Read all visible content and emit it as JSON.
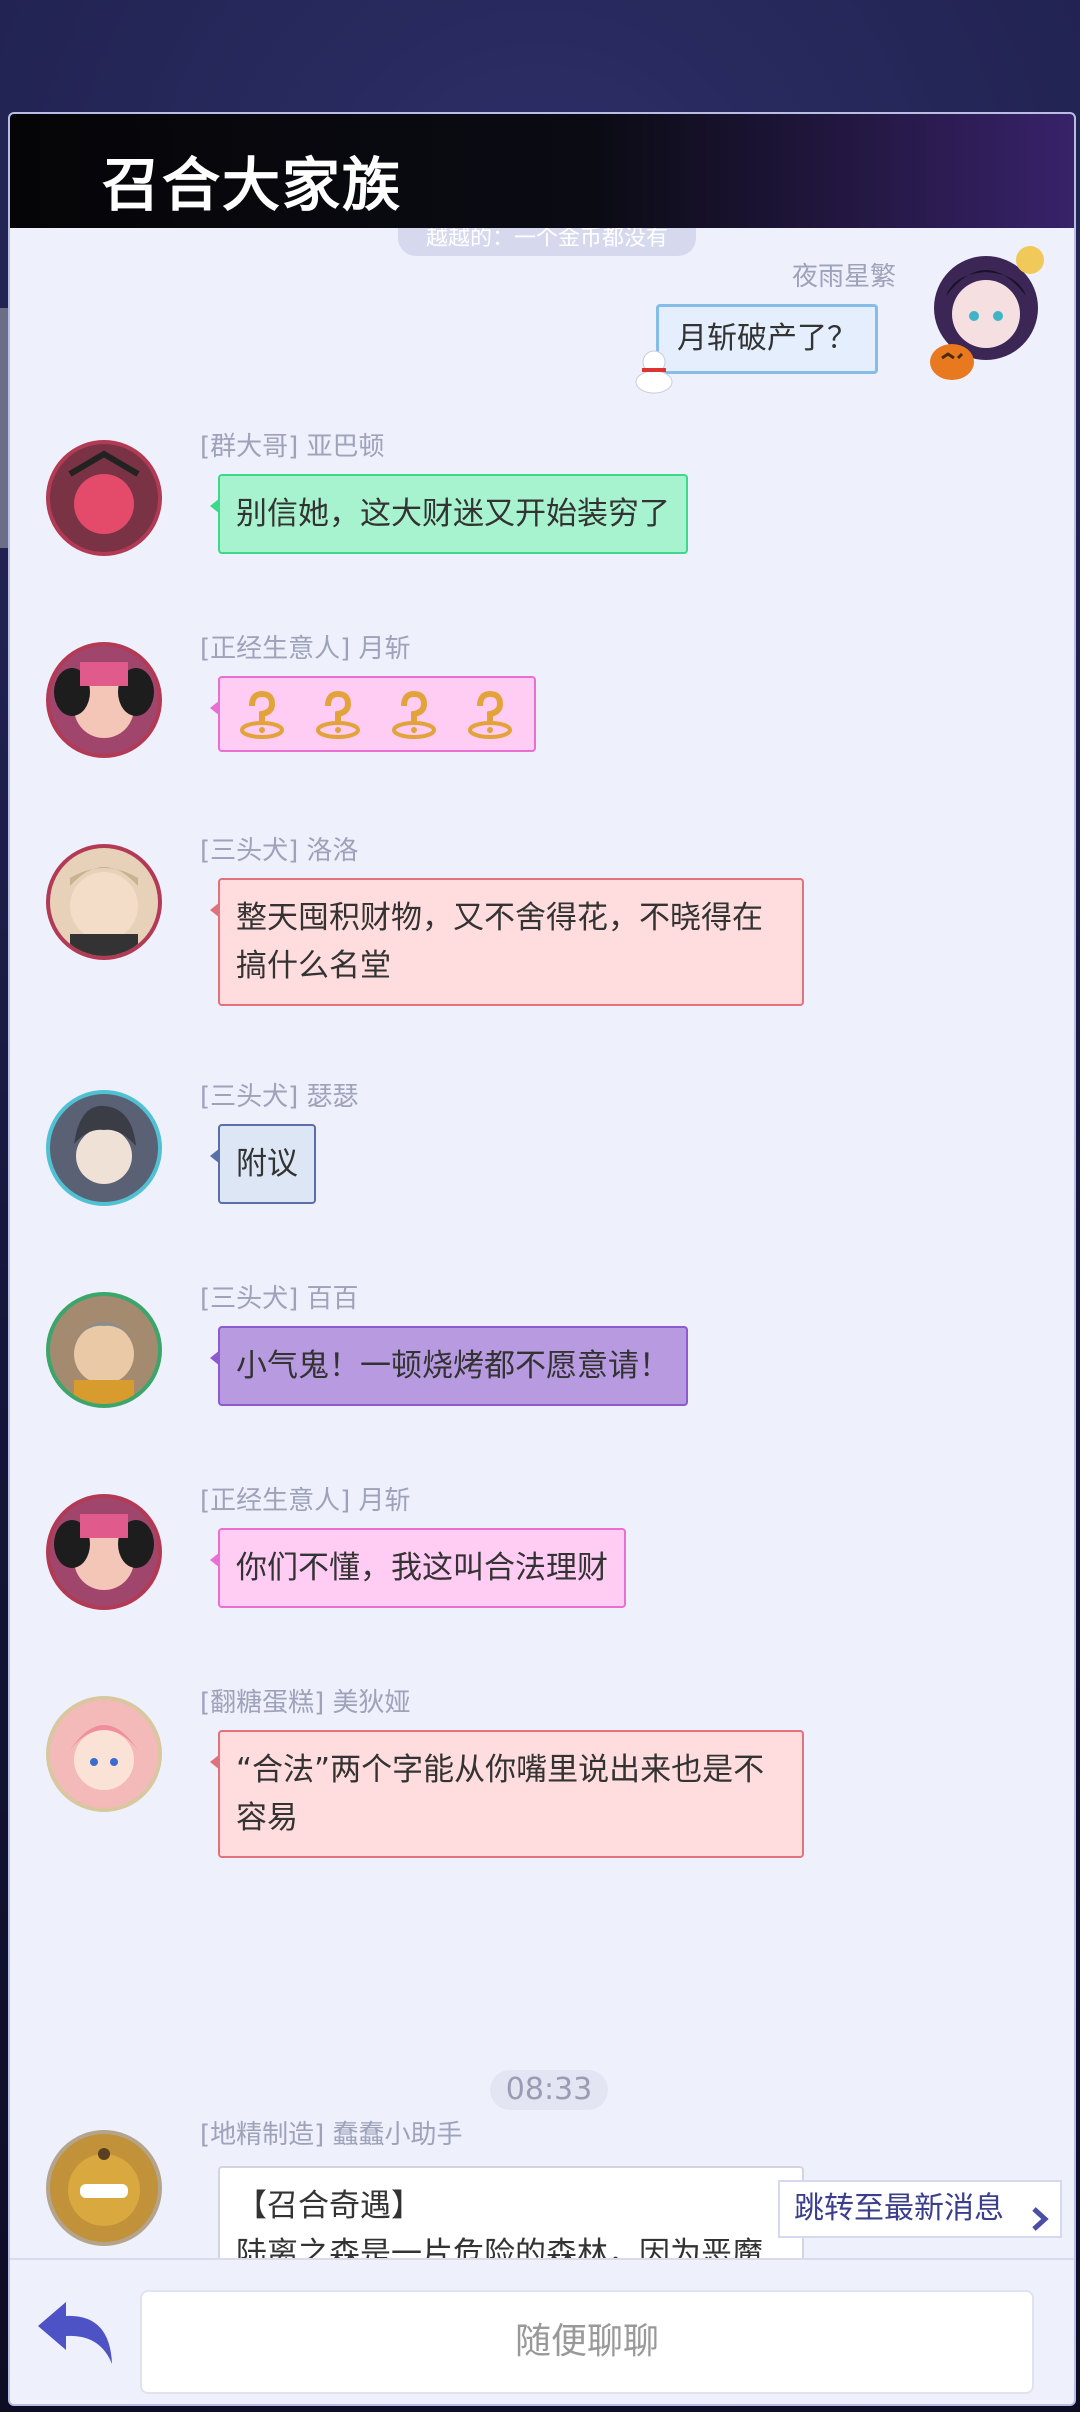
{
  "header": {
    "title": "召合大家族"
  },
  "top_pill": "越越的：一个金币都没有",
  "me": {
    "name": "夜雨星繁",
    "message": "月斩破产了？"
  },
  "messages": [
    {
      "tag": "[群大哥] 亚巴顿",
      "text": "别信她，这大财迷又开始装穷了",
      "bubble": "#a8f3cf",
      "border": "#3dd98b",
      "avatar": "#7a3344"
    },
    {
      "tag": "[正经生意人] 月斩",
      "text": "",
      "stickers": [
        "question-sticker",
        "question-sticker",
        "question-sticker",
        "question-sticker"
      ],
      "bubble": "#ffccf3",
      "border": "#e96fd3",
      "avatar": "#a0456c"
    },
    {
      "tag": "[三头犬] 洛洛",
      "text": "整天囤积财物，又不舍得花，不晓得在搞什么名堂",
      "bubble": "#ffdcdd",
      "border": "#e2717e",
      "avatar": "#e7d1b9"
    },
    {
      "tag": "[三头犬] 瑟瑟",
      "text": "附议",
      "bubble": "#dde6f5",
      "border": "#5a6fa8",
      "avatar": "#5a6174"
    },
    {
      "tag": "[三头犬] 百百",
      "text": "小气鬼！一顿烧烤都不愿意请！",
      "bubble": "#b79ae0",
      "border": "#8e5ad0",
      "avatar": "#a48a6f"
    },
    {
      "tag": "[正经生意人] 月斩",
      "text": "你们不懂，我这叫合法理财",
      "bubble": "#ffccf3",
      "border": "#e96fd3",
      "avatar": "#a0456c"
    },
    {
      "tag": "[翻糖蛋糕] 美狄娅",
      "text": "“合法”两个字能从你嘴里说出来也是不容易",
      "bubble": "#ffdcdd",
      "border": "#e2717e",
      "avatar": "#f4b9b9"
    }
  ],
  "time_label": "08:33",
  "system_message": {
    "tag": "[地精制造] 蠢蠢小助手",
    "title": "【召合奇遇】",
    "text": "陆离之森是一片危险的森林，因为恶魔偶尔会潜入此处，寻觅他们所稀缺的自",
    "avatar": "#c2923a"
  },
  "jump_button": "跳转至最新消息",
  "input_placeholder": "随便聊聊"
}
